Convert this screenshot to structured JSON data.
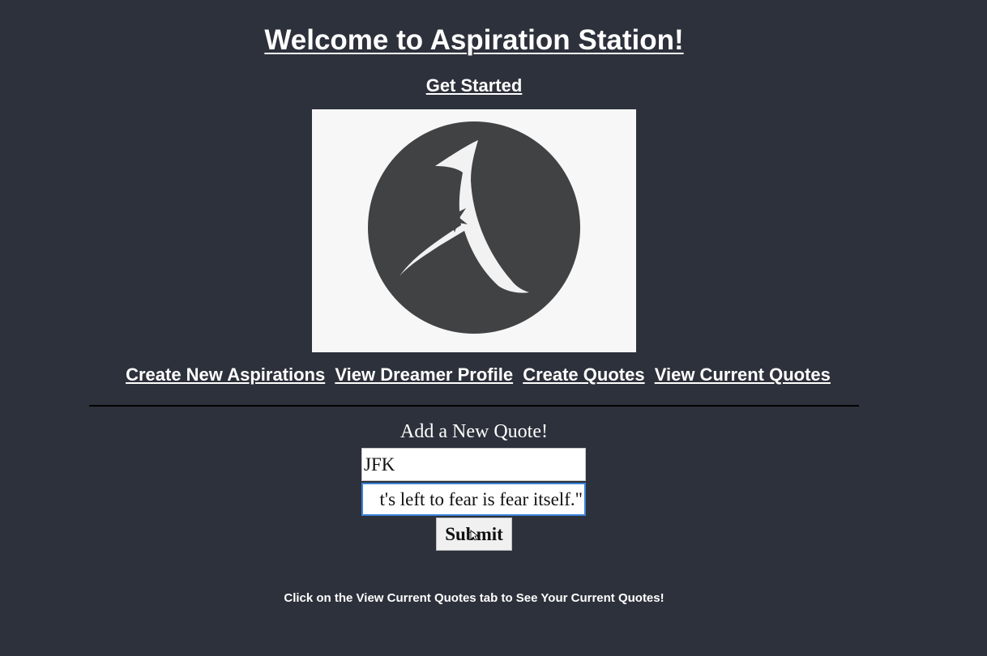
{
  "header": {
    "title": "Welcome to Aspiration Station!",
    "get_started": "Get Started"
  },
  "logo": {
    "icon": "aspiration-station-logo-a",
    "background": "#f7f7f7",
    "circle_color": "#404244"
  },
  "nav": {
    "items": [
      "Create New Aspirations",
      "View Dreamer Profile",
      "Create Quotes",
      "View Current Quotes"
    ]
  },
  "form": {
    "heading": "Add a New Quote!",
    "author_value": "JFK",
    "quote_value": "\"The only thing we have to fear is the fear itself. That's left to fear is fear itself.\"",
    "quote_visible": "t's left to fear is fear itself.\"",
    "submit_label": "Submit"
  },
  "footer": {
    "note": "Click on the View Current Quotes tab to See Your Current Quotes!"
  },
  "colors": {
    "page_background": "#2d313b",
    "focus_border": "#3b82d6"
  }
}
